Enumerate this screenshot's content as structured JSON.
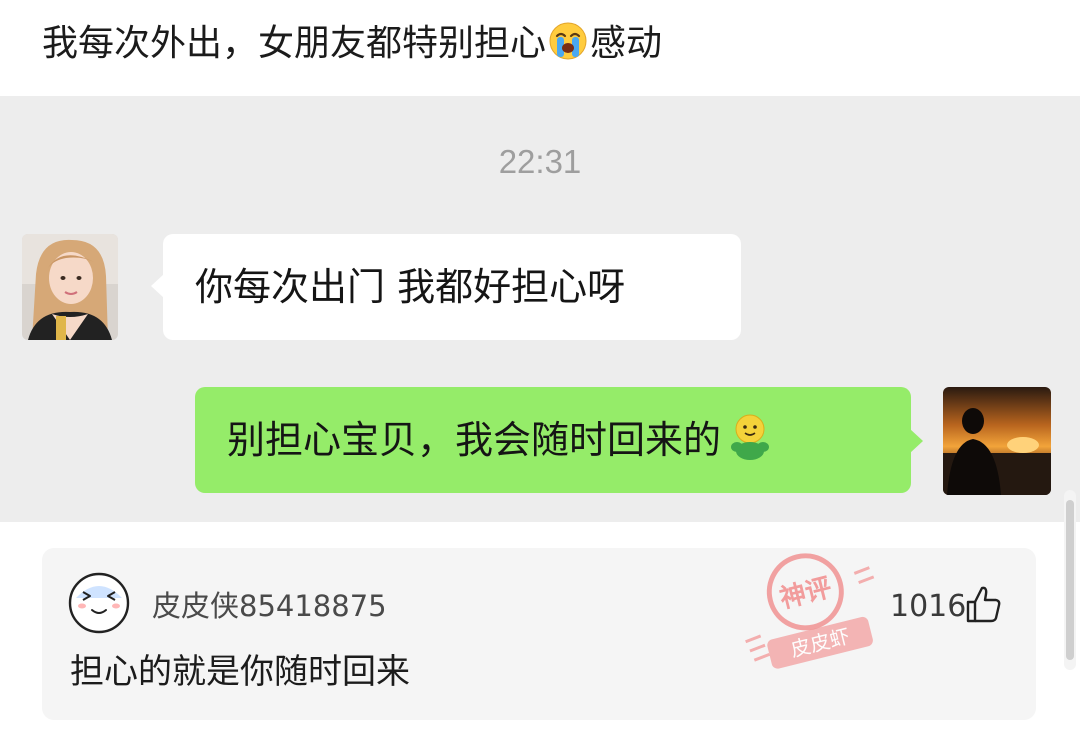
{
  "post": {
    "title_before": "我每次外出，女朋友都特别担心",
    "title_emoji": "loudly-crying-face-icon",
    "title_after": "感动"
  },
  "chat": {
    "time": "22:31",
    "incoming_message": "你每次出门 我都好担心呀",
    "outgoing_message": "别担心宝贝，我会随时回来的",
    "outgoing_emoji": "hug-emoji-icon",
    "incoming_bubble_color": "#ffffff",
    "outgoing_bubble_color": "#95ec69",
    "background_color": "#ededed"
  },
  "comment": {
    "username": "皮皮侠85418875",
    "text": "担心的就是你随时回来",
    "like_count": "1016",
    "like_icon": "thumbs-up-icon"
  },
  "watermark": {
    "line1": "神评",
    "line2": "皮皮虾",
    "color": "#f06a6a"
  }
}
